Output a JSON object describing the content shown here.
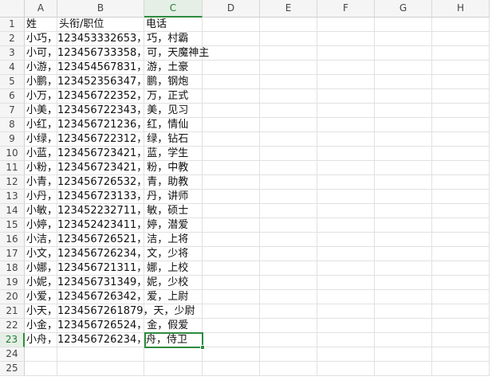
{
  "columns": [
    "A",
    "B",
    "C",
    "D",
    "E",
    "F",
    "G",
    "H"
  ],
  "rows": [
    "1",
    "2",
    "3",
    "4",
    "5",
    "6",
    "7",
    "8",
    "9",
    "10",
    "11",
    "12",
    "13",
    "14",
    "15",
    "16",
    "17",
    "18",
    "19",
    "20",
    "21",
    "22",
    "23",
    "24",
    "25"
  ],
  "cells": [
    [
      "姓",
      "头衔/职位",
      "电话"
    ],
    [
      "小巧，123453332653，巧，村霸",
      "",
      ""
    ],
    [
      "小可，123456733358，可，天魔神主",
      "",
      ""
    ],
    [
      "小游，123454567831，游，土豪",
      "",
      ""
    ],
    [
      "小鹏，123452356347，鹏，钢炮",
      "",
      ""
    ],
    [
      "小万，123456722352，万，正式",
      "",
      ""
    ],
    [
      "小美，123456722343，美，见习",
      "",
      ""
    ],
    [
      "小红，123456721236，红，情仙",
      "",
      ""
    ],
    [
      "小绿，123456722312，绿，钻石",
      "",
      ""
    ],
    [
      "小蓝，123456723421，蓝，学生",
      "",
      ""
    ],
    [
      "小粉，123456723421，粉，中教",
      "",
      ""
    ],
    [
      "小青，123456726532，青，助教",
      "",
      ""
    ],
    [
      "小丹，123456723133，丹，讲师",
      "",
      ""
    ],
    [
      "小敏，123452232711，敏，硕士",
      "",
      ""
    ],
    [
      "小婷，123452423411，婷，潜爱",
      "",
      ""
    ],
    [
      "小洁，123456726521，洁，上将",
      "",
      ""
    ],
    [
      "小文，123456726234，文，少将",
      "",
      ""
    ],
    [
      "小娜，123456721311，娜，上校",
      "",
      ""
    ],
    [
      "小妮，123456731349，妮，少校",
      "",
      ""
    ],
    [
      "小爱，123456726342，爱，上尉",
      "",
      ""
    ],
    [
      "小天，1234567261879，天，少尉",
      "",
      ""
    ],
    [
      "小金，123456726524，金，假爱",
      "",
      ""
    ],
    [
      "小舟，123456726234，",
      "",
      "舟，侍卫"
    ],
    [
      "",
      "",
      ""
    ],
    [
      "",
      "",
      ""
    ]
  ],
  "selection": {
    "cell": "C23",
    "column": "C",
    "row": "23"
  },
  "colors": {
    "accent": "#2e8b3e",
    "header_bg": "#f5f5f5",
    "gridline": "#e1e1e1"
  }
}
